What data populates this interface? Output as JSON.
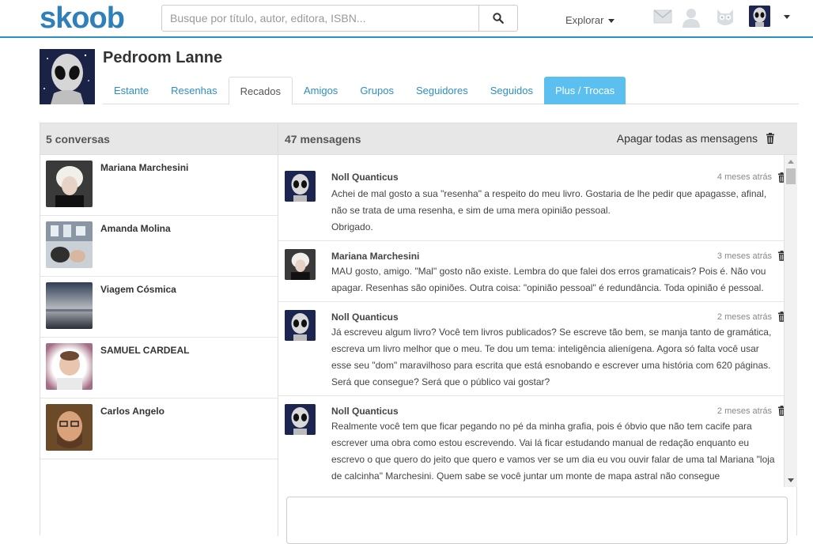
{
  "header": {
    "logo": "skoob",
    "search_placeholder": "Busque por título, autor, editora, ISBN...",
    "explore_label": "Explorar"
  },
  "profile": {
    "name": "Pedroom Lanne",
    "tabs": [
      {
        "label": "Estante"
      },
      {
        "label": "Resenhas"
      },
      {
        "label": "Recados"
      },
      {
        "label": "Amigos"
      },
      {
        "label": "Grupos"
      },
      {
        "label": "Seguidores"
      },
      {
        "label": "Seguidos"
      },
      {
        "label": "Plus / Trocas"
      }
    ]
  },
  "conversations": {
    "title": "5 conversas",
    "items": [
      {
        "name": "Mariana Marchesini"
      },
      {
        "name": "Amanda Molina"
      },
      {
        "name": "Viagem Cósmica"
      },
      {
        "name": "SAMUEL CARDEAL"
      },
      {
        "name": "Carlos Angelo"
      }
    ]
  },
  "messages": {
    "title": "47 mensagens",
    "clear_all": "Apagar todas as mensagens",
    "items": [
      {
        "author": "Noll Quanticus",
        "time": "4 meses atrás",
        "text": "Achei de mal gosto a sua \"resenha\" a respeito do meu livro. Gostaria de lhe pedir que apagasse, afinal, não se trata de uma resenha, e sim de uma mera opinião pessoal.\nObrigado."
      },
      {
        "author": "Mariana Marchesini",
        "time": "3 meses atrás",
        "text": "MAU gosto, amigo. \"Mal\" gosto não existe. Lembra do que falei dos erros gramaticais? Pois é. Não vou apagar. Resenhas são opiniões. Outra coisa: \"opinião pessoal\" é redundância. Toda opinião é pessoal."
      },
      {
        "author": "Noll Quanticus",
        "time": "2 meses atrás",
        "text": "Já escreveu algum livro? Você tem livros publicados? Se escreve tão bem, se manja tanto de gramática, escreva um livro melhor que o meu. Te dou um tema: inteligência alienígena. Agora só falta você usar esse seu \"dom\" maravilhoso para escrita que está esnobando e escrever uma história com 620 páginas. Será que consegue? Será que o público vai gostar?"
      },
      {
        "author": "Noll Quanticus",
        "time": "2 meses atrás",
        "text": "Realmente você tem que ficar pegando no pé da minha grafia, pois é óbvio que não tem cacife para escrever uma obra como estou escrevendo. Vai lá ficar estudando manual de redação enquanto eu escrevo o que quero do jeito que quero e vamos ver se um dia eu vou ouvir falar de uma tal Mariana \"loja de calcinha\" Marchesini. Quem sabe se você juntar um monte de mapa astral não consegue"
      }
    ]
  },
  "colors": {
    "brand": "#2f7fb8",
    "link": "#2c8fc4",
    "plus_tab": "#5bc0f0"
  }
}
